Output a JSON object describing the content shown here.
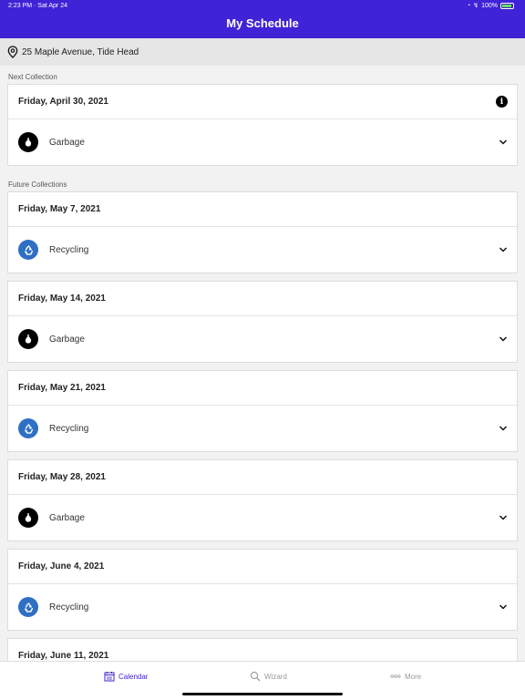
{
  "status_bar": {
    "time_date": "2:23 PM · Sat Apr 24",
    "battery": "100%"
  },
  "header": {
    "title": "My Schedule"
  },
  "address": {
    "text": "25 Maple Avenue, Tide Head"
  },
  "sections": [
    {
      "label": "Next Collection",
      "cards": [
        {
          "date": "Friday, April 30, 2021",
          "type": "Garbage",
          "icon": "garbage-bag-icon",
          "info": true
        }
      ]
    },
    {
      "label": "Future Collections",
      "cards": [
        {
          "date": "Friday, May 7, 2021",
          "type": "Recycling",
          "icon": "recycling-icon"
        },
        {
          "date": "Friday, May 14, 2021",
          "type": "Garbage",
          "icon": "garbage-bag-icon"
        },
        {
          "date": "Friday, May 21, 2021",
          "type": "Recycling",
          "icon": "recycling-icon"
        },
        {
          "date": "Friday, May 28, 2021",
          "type": "Garbage",
          "icon": "garbage-bag-icon"
        },
        {
          "date": "Friday, June 4, 2021",
          "type": "Recycling",
          "icon": "recycling-icon"
        },
        {
          "date": "Friday, June 11, 2021",
          "type": "",
          "icon": ""
        }
      ]
    }
  ],
  "tabbar": {
    "calendar": "Calendar",
    "wizard": "Wizard",
    "more": "More"
  },
  "colors": {
    "accent": "#3f23d6",
    "recycling": "#2f6fc4",
    "garbage": "#000000"
  }
}
